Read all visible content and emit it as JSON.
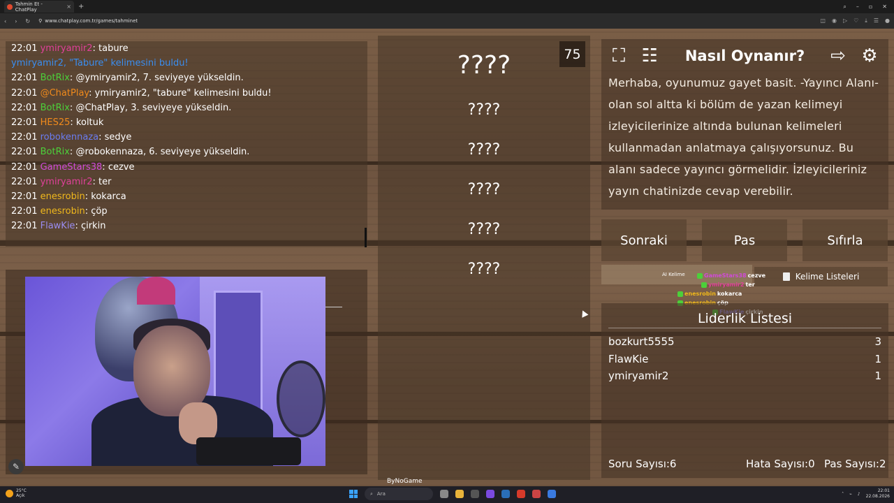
{
  "browser": {
    "tab_title": "Tahmin Et - ChatPlay",
    "url": "www.chatplay.com.tr/games/tahminet",
    "new_tab": "+",
    "tab_close": "×"
  },
  "chat": [
    {
      "time": "22:01",
      "user": "ymiryamir2",
      "user_color": "#e0409a",
      "sep": ": ",
      "msg": "tabure",
      "msg_color": "#ffffff"
    },
    {
      "time": "",
      "user": "ymiryamir2, \"Tabure\" kelimesini buldu!",
      "user_color": "#3a8ef0",
      "sep": "",
      "msg": "",
      "msg_color": "#3a8ef0"
    },
    {
      "time": "22:01",
      "user": "BotRix",
      "user_color": "#4ccf3a",
      "sep": ": ",
      "msg": "@ymiryamir2, 7. seviyeye yükseldin.",
      "msg_color": "#ffffff"
    },
    {
      "time": "22:01",
      "user": "@ChatPlay",
      "user_color": "#f08a1c",
      "sep": ": ",
      "msg": "ymiryamir2, \"tabure\" kelimesini buldu!",
      "msg_color": "#ffffff"
    },
    {
      "time": "22:01",
      "user": "BotRix",
      "user_color": "#4ccf3a",
      "sep": ": ",
      "msg": "@ChatPlay, 3. seviyeye yükseldin.",
      "msg_color": "#ffffff"
    },
    {
      "time": "22:01",
      "user": "HES25",
      "user_color": "#f08a1c",
      "sep": ": ",
      "msg": "koltuk",
      "msg_color": "#ffffff"
    },
    {
      "time": "22:01",
      "user": "robokennaza",
      "user_color": "#6a7cf0",
      "sep": ": ",
      "msg": "sedye",
      "msg_color": "#ffffff"
    },
    {
      "time": "22:01",
      "user": "BotRix",
      "user_color": "#4ccf3a",
      "sep": ": ",
      "msg": "@robokennaza, 6. seviyeye yükseldin.",
      "msg_color": "#ffffff"
    },
    {
      "time": "22:01",
      "user": "GameStars38",
      "user_color": "#d04ad8",
      "sep": ": ",
      "msg": "cezve",
      "msg_color": "#ffffff"
    },
    {
      "time": "22:01",
      "user": "ymiryamir2",
      "user_color": "#e0409a",
      "sep": ": ",
      "msg": "ter",
      "msg_color": "#ffffff"
    },
    {
      "time": "22:01",
      "user": "enesrobin",
      "user_color": "#f0b81c",
      "sep": ": ",
      "msg": "kokarca",
      "msg_color": "#ffffff"
    },
    {
      "time": "22:01",
      "user": "enesrobin",
      "user_color": "#f0b81c",
      "sep": ": ",
      "msg": "çöp",
      "msg_color": "#ffffff"
    },
    {
      "time": "22:01",
      "user": "FlawKie",
      "user_color": "#9a8cf0",
      "sep": ": ",
      "msg": "çirkin",
      "msg_color": "#ffffff"
    }
  ],
  "words": {
    "main": "????",
    "hidden": [
      "????",
      "????",
      "????",
      "????",
      "????"
    ]
  },
  "timer": "75",
  "howto": {
    "title": "Nasıl Oynanır?",
    "text": "Merhaba, oyunumuz gayet basit. -Yayıncı Alanı- olan sol altta ki bölüm de yazan kelimeyi izleyicilerinize altında bulunan kelimeleri kullanmadan anlatmaya çalışıyorsunuz. Bu alanı sadece yayıncı görmelidir. İzleyicileriniz yayın chatinizde cevap verebilir."
  },
  "buttons": {
    "next": "Sonraki",
    "pass": "Pas",
    "reset": "Sıfırla"
  },
  "ai_label": "AI Kelime",
  "lists_label": "Kelime Listeleri",
  "mini_chat": [
    {
      "user": "GameStars38",
      "color": "#d04ad8",
      "msg": "cezve"
    },
    {
      "user": "ymiryamir2",
      "color": "#e0409a",
      "msg": "ter"
    },
    {
      "user": "enesrobin",
      "color": "#f0b81c",
      "msg": "kokarca"
    },
    {
      "user": "enesrobin",
      "color": "#f0b81c",
      "msg": "çöp"
    },
    {
      "user": "FlawKie",
      "color": "#9a8cf0",
      "msg": "çirkin"
    }
  ],
  "leaderboard": {
    "title": "Liderlik Listesi",
    "rows": [
      {
        "name": "bozkurt5555",
        "score": "3"
      },
      {
        "name": "FlawKie",
        "score": "1"
      },
      {
        "name": "ymiryamir2",
        "score": "1"
      }
    ]
  },
  "stats": {
    "questions": "Soru Sayısı:6",
    "errors": "Hata Sayısı:0",
    "passes": "Pas Sayısı:2"
  },
  "watermark": "ByNoGame",
  "taskbar": {
    "temp": "25°C",
    "weather": "Açık",
    "search": "Ara",
    "time": "22:01",
    "date": "22.08.2026"
  }
}
